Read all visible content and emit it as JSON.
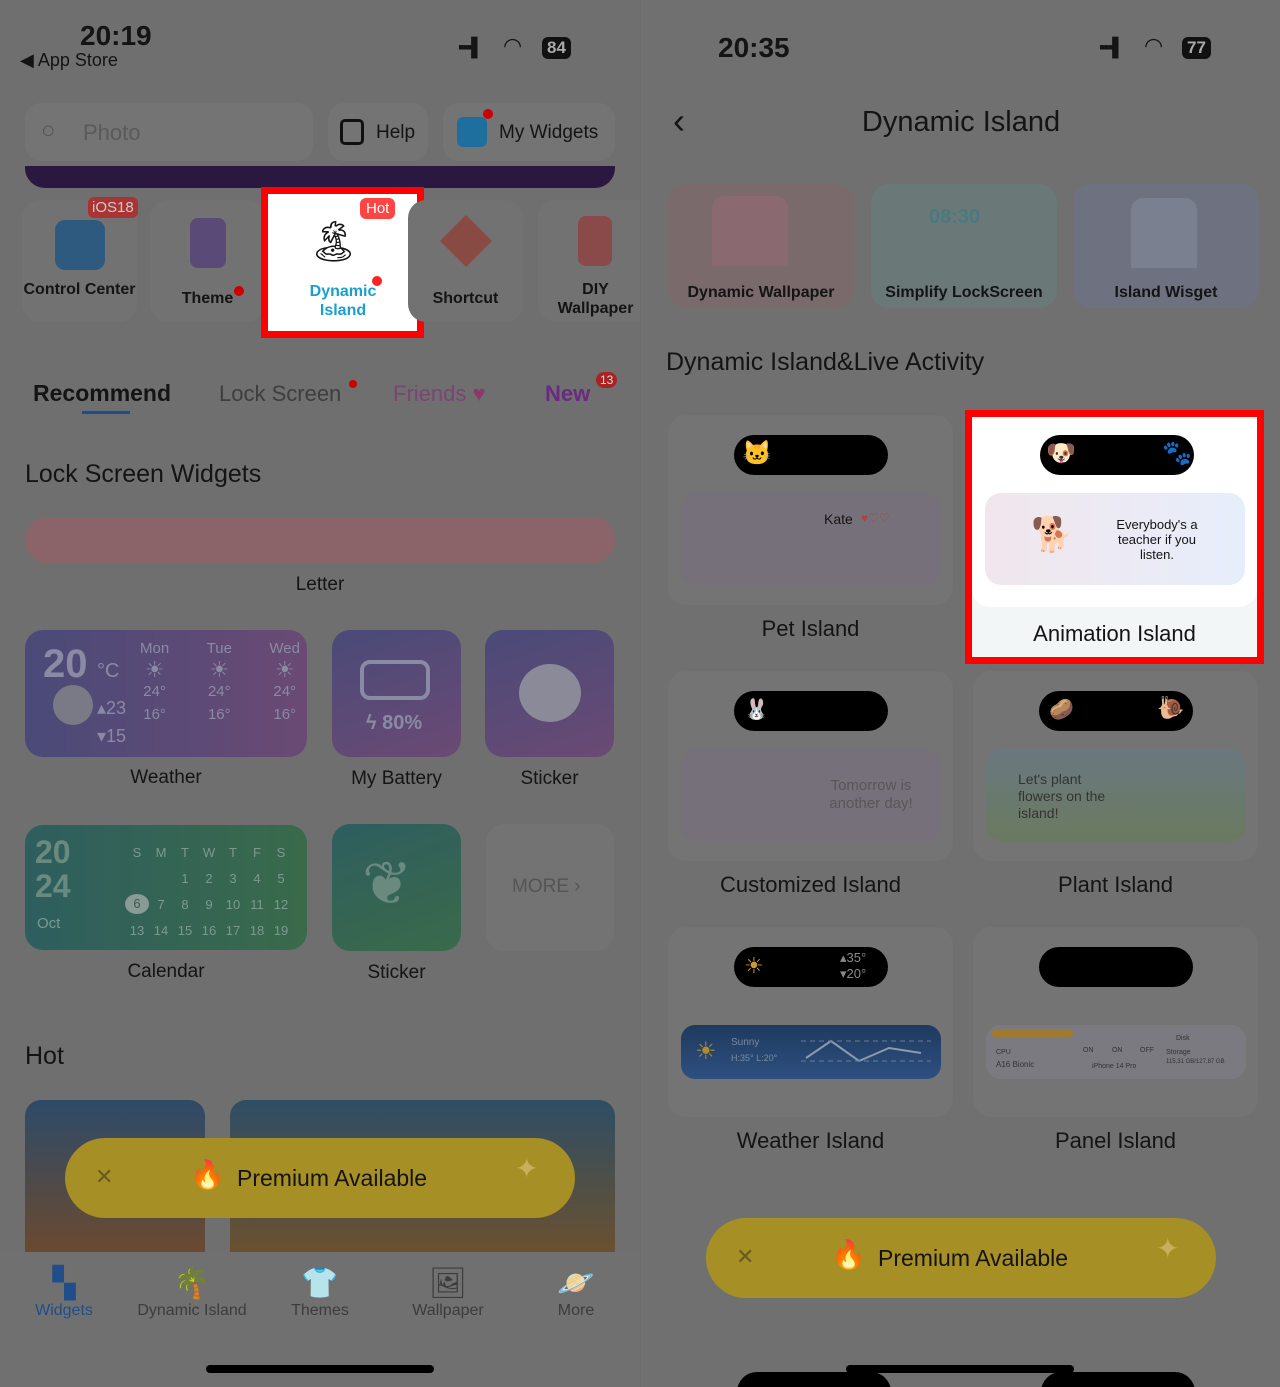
{
  "left": {
    "status": {
      "time": "20:19",
      "back": "App Store",
      "battery": "84"
    },
    "search": {
      "placeholder": "Photo"
    },
    "help": "Help",
    "my_widgets": "My Widgets",
    "functions": [
      {
        "label": "Control Center",
        "badge": "iOS18"
      },
      {
        "label": "Theme"
      },
      {
        "label": "Dynamic Island",
        "badge": "Hot"
      },
      {
        "label": "Shortcut"
      },
      {
        "label": "DIY Wallpaper"
      }
    ],
    "tabs": [
      {
        "label": "Recommend",
        "active": true
      },
      {
        "label": "Lock Screen"
      },
      {
        "label": "Friends"
      },
      {
        "label": "New",
        "badge": "13"
      }
    ],
    "lock_section": "Lock Screen Widgets",
    "letter": "Letter",
    "weather": {
      "label": "Weather",
      "temp": "20",
      "unit": "°C",
      "high": "23",
      "low": "15",
      "days": [
        "Mon",
        "Tue",
        "Wed"
      ],
      "highs": [
        "24°",
        "24°",
        "24°"
      ],
      "lows": [
        "16°",
        "16°",
        "16°"
      ]
    },
    "battery": {
      "label": "My Battery",
      "value": "80%"
    },
    "sticker1": "Sticker",
    "calendar": {
      "label": "Calendar",
      "year1": "20",
      "year2": "24",
      "month": "Oct",
      "weekdays": [
        "S",
        "M",
        "T",
        "W",
        "T",
        "F",
        "S"
      ],
      "row1": [
        "1",
        "2",
        "3",
        "4",
        "5"
      ],
      "row2": [
        "6",
        "7",
        "8",
        "9",
        "10",
        "11",
        "12"
      ],
      "row3": [
        "13",
        "14",
        "15",
        "16",
        "17",
        "18",
        "19"
      ]
    },
    "sticker2": "Sticker",
    "more": "MORE",
    "hot": "Hot",
    "premium": "Premium Available",
    "nav": [
      {
        "label": "Widgets",
        "active": true
      },
      {
        "label": "Dynamic Island"
      },
      {
        "label": "Themes"
      },
      {
        "label": "Wallpaper"
      },
      {
        "label": "More"
      }
    ]
  },
  "right": {
    "status": {
      "time": "20:35",
      "battery": "77"
    },
    "title": "Dynamic Island",
    "top_cards": [
      "Dynamic Wallpaper",
      "Simplify LockScreen",
      "Island Wisget"
    ],
    "lock_time": "08:30",
    "section": "Dynamic Island&Live Activity",
    "islands": [
      {
        "label": "Pet Island",
        "name": "Kate"
      },
      {
        "label": "Animation Island",
        "quote": "Everybody's a teacher if you listen."
      },
      {
        "label": "Customized Island",
        "text": "Tomorrow is another day!"
      },
      {
        "label": "Plant Island",
        "text": "Let's plant flowers on the island!"
      },
      {
        "label": "Weather Island",
        "high": "35°",
        "low": "20°",
        "cond": "Sunny",
        "hl": "H:35° L:20°"
      },
      {
        "label": "Panel Island",
        "cpu": "CPU",
        "chip": "A16 Bionic",
        "on1": "ON",
        "on2": "ON",
        "off": "OFF",
        "device": "iPhone 14 Pro",
        "disk": "Disk",
        "storage": "Storage",
        "usage": "115,31 GB/127,87 GB"
      }
    ],
    "premium": "Premium Available"
  },
  "colors": {
    "highlight": "#ff0000",
    "accent": "#1a73e8",
    "premium": "#f0cc3c"
  }
}
